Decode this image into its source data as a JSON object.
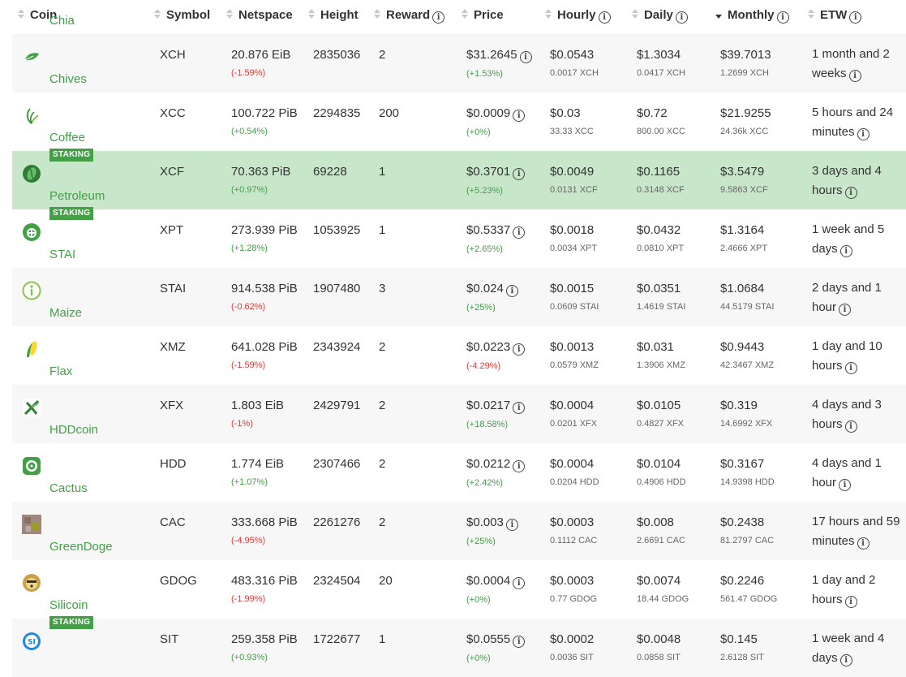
{
  "headers": {
    "coin": "Coin",
    "symbol": "Symbol",
    "netspace": "Netspace",
    "height": "Height",
    "reward": "Reward",
    "price": "Price",
    "hourly": "Hourly",
    "daily": "Daily",
    "monthly": "Monthly",
    "etw": "ETW"
  },
  "colors": {
    "accent": "#43a047",
    "negative": "#e53935",
    "highlight_row": "#c8e6c9"
  },
  "coins": [
    {
      "name": "Chia",
      "icon": "chia-leaf-icon",
      "symbol": "XCH",
      "netspace": "20.876 EiB",
      "netspace_change": "(-1.59%)",
      "height": "2835036",
      "reward": "2",
      "price": "$31.2645",
      "price_change": "(+1.53%)",
      "hourly": "$0.0543",
      "hourly_coin": "0.0017 XCH",
      "daily": "$1.3034",
      "daily_coin": "0.0417 XCH",
      "monthly": "$39.7013",
      "monthly_coin": "1.2699 XCH",
      "etw1": "1 month and 2",
      "etw2": "weeks",
      "staking": ""
    },
    {
      "name": "Chives",
      "icon": "chives-sprout-icon",
      "symbol": "XCC",
      "netspace": "100.722 PiB",
      "netspace_change": "(+0.54%)",
      "height": "2294835",
      "reward": "200",
      "price": "$0.0009",
      "price_change": "(+0%)",
      "hourly": "$0.03",
      "hourly_coin": "33.33 XCC",
      "daily": "$0.72",
      "daily_coin": "800.00 XCC",
      "monthly": "$21.9255",
      "monthly_coin": "24.36k XCC",
      "etw1": "5 hours and 24",
      "etw2": "minutes",
      "staking": ""
    },
    {
      "name": "Coffee",
      "icon": "coffee-bean-icon",
      "symbol": "XCF",
      "netspace": "70.363 PiB",
      "netspace_change": "(+0.97%)",
      "height": "69228",
      "reward": "1",
      "price": "$0.3701",
      "price_change": "(+5.23%)",
      "hourly": "$0.0049",
      "hourly_coin": "0.0131 XCF",
      "daily": "$0.1165",
      "daily_coin": "0.3148 XCF",
      "monthly": "$3.5479",
      "monthly_coin": "9.5863 XCF",
      "etw1": "3 days and 4",
      "etw2": "hours",
      "staking": "STAKING"
    },
    {
      "name": "Petroleum",
      "icon": "petroleum-drop-icon",
      "symbol": "XPT",
      "netspace": "273.939 PiB",
      "netspace_change": "(+1.28%)",
      "height": "1053925",
      "reward": "1",
      "price": "$0.5337",
      "price_change": "(+2.65%)",
      "hourly": "$0.0018",
      "hourly_coin": "0.0034 XPT",
      "daily": "$0.0432",
      "daily_coin": "0.0810 XPT",
      "monthly": "$1.3164",
      "monthly_coin": "2.4666 XPT",
      "etw1": "1 week and 5",
      "etw2": "days",
      "staking": "STAKING"
    },
    {
      "name": "STAI",
      "icon": "stai-info-circle-icon",
      "symbol": "STAI",
      "netspace": "914.538 PiB",
      "netspace_change": "(-0.62%)",
      "height": "1907480",
      "reward": "3",
      "price": "$0.024",
      "price_change": "(+25%)",
      "hourly": "$0.0015",
      "hourly_coin": "0.0609 STAI",
      "daily": "$0.0351",
      "daily_coin": "1.4619 STAI",
      "monthly": "$1.0684",
      "monthly_coin": "44.5179 STAI",
      "etw1": "2 days and 1",
      "etw2": "hour",
      "staking": ""
    },
    {
      "name": "Maize",
      "icon": "maize-corn-icon",
      "symbol": "XMZ",
      "netspace": "641.028 PiB",
      "netspace_change": "(-1.59%)",
      "height": "2343924",
      "reward": "2",
      "price": "$0.0223",
      "price_change": "(-4.29%)",
      "hourly": "$0.0013",
      "hourly_coin": "0.0579 XMZ",
      "daily": "$0.031",
      "daily_coin": "1.3906 XMZ",
      "monthly": "$0.9443",
      "monthly_coin": "42.3467 XMZ",
      "etw1": "1 day and 10",
      "etw2": "hours",
      "staking": ""
    },
    {
      "name": "Flax",
      "icon": "flax-leaves-icon",
      "symbol": "XFX",
      "netspace": "1.803 EiB",
      "netspace_change": "(-1%)",
      "height": "2429791",
      "reward": "2",
      "price": "$0.0217",
      "price_change": "(+18.58%)",
      "hourly": "$0.0004",
      "hourly_coin": "0.0201 XFX",
      "daily": "$0.0105",
      "daily_coin": "0.4827 XFX",
      "monthly": "$0.319",
      "monthly_coin": "14.6992 XFX",
      "etw1": "4 days and 3",
      "etw2": "hours",
      "staking": ""
    },
    {
      "name": "HDDcoin",
      "icon": "hddcoin-icon",
      "symbol": "HDD",
      "netspace": "1.774 EiB",
      "netspace_change": "(+1.07%)",
      "height": "2307466",
      "reward": "2",
      "price": "$0.0212",
      "price_change": "(+2.42%)",
      "hourly": "$0.0004",
      "hourly_coin": "0.0204 HDD",
      "daily": "$0.0104",
      "daily_coin": "0.4906 HDD",
      "monthly": "$0.3167",
      "monthly_coin": "14.9398 HDD",
      "etw1": "4 days and 1",
      "etw2": "hour",
      "staking": ""
    },
    {
      "name": "Cactus",
      "icon": "cactus-icon",
      "symbol": "CAC",
      "netspace": "333.668 PiB",
      "netspace_change": "(-4.95%)",
      "height": "2261276",
      "reward": "2",
      "price": "$0.003",
      "price_change": "(+25%)",
      "hourly": "$0.0003",
      "hourly_coin": "0.1112 CAC",
      "daily": "$0.008",
      "daily_coin": "2.6691 CAC",
      "monthly": "$0.2438",
      "monthly_coin": "81.2797 CAC",
      "etw1": "17 hours and 59",
      "etw2": "minutes",
      "staking": ""
    },
    {
      "name": "GreenDoge",
      "icon": "greendoge-icon",
      "symbol": "GDOG",
      "netspace": "483.316 PiB",
      "netspace_change": "(-1.99%)",
      "height": "2324504",
      "reward": "20",
      "price": "$0.0004",
      "price_change": "(+0%)",
      "hourly": "$0.0003",
      "hourly_coin": "0.77 GDOG",
      "daily": "$0.0074",
      "daily_coin": "18.44 GDOG",
      "monthly": "$0.2246",
      "monthly_coin": "561.47 GDOG",
      "etw1": "1 day and 2",
      "etw2": "hours",
      "staking": ""
    },
    {
      "name": "Silicoin",
      "icon": "silicoin-icon",
      "symbol": "SIT",
      "netspace": "259.358 PiB",
      "netspace_change": "(+0.93%)",
      "height": "1722677",
      "reward": "1",
      "price": "$0.0555",
      "price_change": "(+0%)",
      "hourly": "$0.0002",
      "hourly_coin": "0.0036 SIT",
      "daily": "$0.0048",
      "daily_coin": "0.0858 SIT",
      "monthly": "$0.145",
      "monthly_coin": "2.6128 SIT",
      "etw1": "1 week and 4",
      "etw2": "days",
      "staking": "STAKING"
    }
  ]
}
